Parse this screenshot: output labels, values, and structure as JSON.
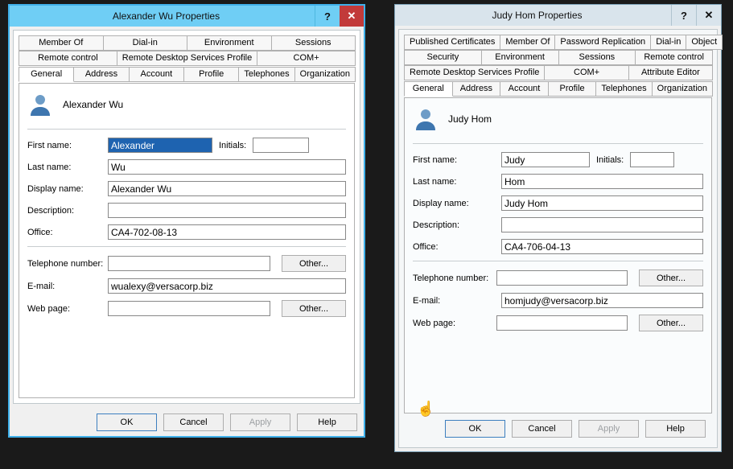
{
  "left": {
    "title": "Alexander Wu Properties",
    "tabs": {
      "row1": [
        "Member Of",
        "Dial-in",
        "Environment",
        "Sessions"
      ],
      "row2": [
        "Remote control",
        "Remote Desktop Services Profile",
        "COM+"
      ],
      "row3": [
        "General",
        "Address",
        "Account",
        "Profile",
        "Telephones",
        "Organization"
      ],
      "active": "General"
    },
    "headerName": "Alexander Wu",
    "fields": {
      "firstNameLabel": "First name:",
      "firstName": "Alexander",
      "initialsLabel": "Initials:",
      "initials": "",
      "lastNameLabel": "Last name:",
      "lastName": "Wu",
      "displayNameLabel": "Display name:",
      "displayName": "Alexander Wu",
      "descriptionLabel": "Description:",
      "description": "",
      "officeLabel": "Office:",
      "office": "CA4-702-08-13",
      "telLabel": "Telephone number:",
      "tel": "",
      "emailLabel": "E-mail:",
      "email": "wualexy@versacorp.biz",
      "webLabel": "Web page:",
      "web": "",
      "otherLabel": "Other..."
    },
    "buttons": {
      "ok": "OK",
      "cancel": "Cancel",
      "apply": "Apply",
      "help": "Help"
    }
  },
  "right": {
    "title": "Judy Hom Properties",
    "tabs": {
      "row1": [
        "Published Certificates",
        "Member Of",
        "Password Replication",
        "Dial-in",
        "Object"
      ],
      "row2": [
        "Security",
        "Environment",
        "Sessions",
        "Remote control"
      ],
      "row3": [
        "Remote Desktop Services Profile",
        "COM+",
        "Attribute Editor"
      ],
      "row4": [
        "General",
        "Address",
        "Account",
        "Profile",
        "Telephones",
        "Organization"
      ],
      "active": "General"
    },
    "headerName": "Judy Hom",
    "fields": {
      "firstNameLabel": "First name:",
      "firstName": "Judy",
      "initialsLabel": "Initials:",
      "initials": "",
      "lastNameLabel": "Last name:",
      "lastName": "Hom",
      "displayNameLabel": "Display name:",
      "displayName": "Judy Hom",
      "descriptionLabel": "Description:",
      "description": "",
      "officeLabel": "Office:",
      "office": "CA4-706-04-13",
      "telLabel": "Telephone number:",
      "tel": "",
      "emailLabel": "E-mail:",
      "email": "homjudy@versacorp.biz",
      "webLabel": "Web page:",
      "web": "",
      "otherLabel": "Other..."
    },
    "buttons": {
      "ok": "OK",
      "cancel": "Cancel",
      "apply": "Apply",
      "help": "Help"
    }
  }
}
